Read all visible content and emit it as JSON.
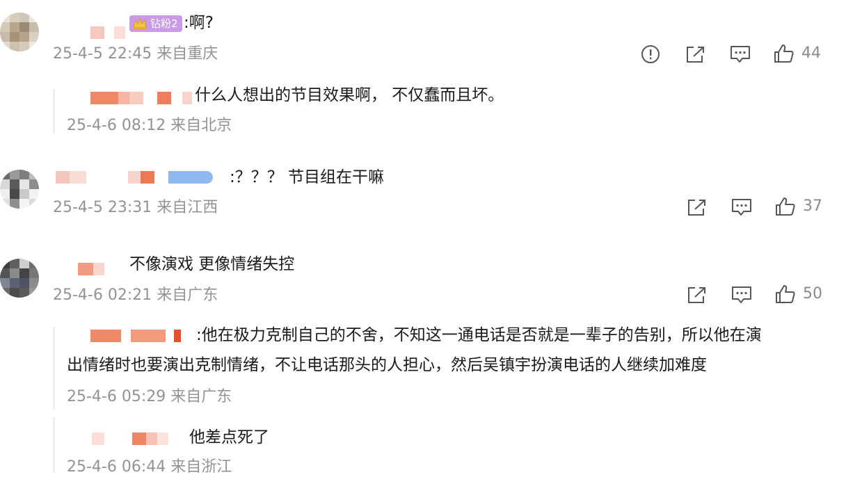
{
  "colors": {
    "text": "#1a1a1a",
    "meta": "#939393",
    "icon": "#555555",
    "badge": "#c99be6"
  },
  "comments": [
    {
      "badge": "钻粉2",
      "text": ":啊?",
      "time": "25-4-5 22:45 来自重庆",
      "likes": "44",
      "icons": [
        "report-icon",
        "share-icon",
        "comment-icon",
        "like-icon"
      ],
      "replies": [
        {
          "text": "什么人想出的节目效果啊， 不仅蠢而且坏。",
          "time": "25-4-6 08:12 来自北京"
        }
      ]
    },
    {
      "text": ":？？？ 节目组在干嘛",
      "time": "25-4-5 23:31 来自江西",
      "likes": "37",
      "icons": [
        "share-icon",
        "comment-icon",
        "like-icon"
      ],
      "replies": []
    },
    {
      "text": "不像演戏 更像情绪失控",
      "time": "25-4-6 02:21 来自广东",
      "likes": "50",
      "icons": [
        "share-icon",
        "comment-icon",
        "like-icon"
      ],
      "replies": [
        {
          "text_line1": ":他在极力克制自己的不舍，不知这一通电话是否就是一辈子的告别，所以他在演",
          "text_line2": "出情绪时也要演出克制情绪，不让电话那头的人担心，然后吴镇宇扮演电话的人继续加难度",
          "time": "25-4-6 05:29 来自广东"
        },
        {
          "text": "他差点死了",
          "time": "25-4-6 06:44 来自浙江"
        }
      ]
    }
  ]
}
